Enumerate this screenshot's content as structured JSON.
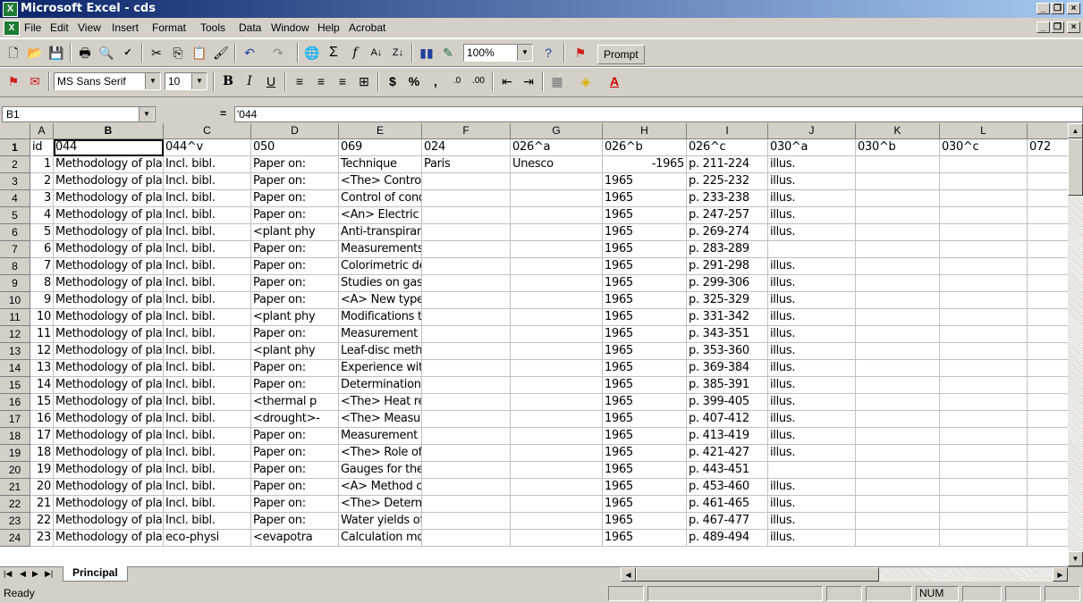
{
  "window": {
    "title": "Microsoft Excel - cds"
  },
  "menu": [
    "File",
    "Edit",
    "View",
    "Insert",
    "Format",
    "Tools",
    "Data",
    "Window",
    "Help",
    "Acrobat"
  ],
  "toolbar": {
    "zoom": "100%",
    "prompt": "Prompt",
    "font_name": "MS Sans Serif",
    "font_size": "10"
  },
  "formula_bar": {
    "cell_ref": "B1",
    "equals": "=",
    "content": "'044"
  },
  "columns": [
    "A",
    "B",
    "C",
    "D",
    "E",
    "F",
    "G",
    "H",
    "I",
    "J",
    "K",
    "L"
  ],
  "rows": [
    [
      "id",
      "044",
      "044^v",
      "050",
      "069",
      "024",
      "026^a",
      "026^b",
      "026^c",
      "030^a",
      "030^b",
      "030^c",
      "072"
    ],
    [
      "1",
      "Methodology of plant",
      "Incl. bibl.",
      "Paper on:",
      "Technique",
      "Paris",
      "Unesco",
      "-1965",
      "p. 211-224",
      "illus.",
      "",
      "",
      ""
    ],
    [
      "2",
      "Methodology of plant",
      "Incl. bibl.",
      "Paper on:",
      "<The> Controlled climate in the p",
      "",
      "",
      "1965",
      "p. 225-232",
      "illus.",
      "",
      "",
      ""
    ],
    [
      "3",
      "Methodology of plant",
      "Incl. bibl.",
      "Paper on:",
      "Control of conditions in the plant",
      "",
      "",
      "1965",
      "p. 233-238",
      "illus.",
      "",
      "",
      ""
    ],
    [
      "4",
      "Methodology of plant",
      "Incl. bibl.",
      "Paper on:",
      "<An> Electric hygrometer appara",
      "",
      "",
      "1965",
      "p. 247-257",
      "illus.",
      "",
      "",
      ""
    ],
    [
      "5",
      "Methodology of plant",
      "Incl. bibl.",
      "<plant phy",
      "Anti-transpirants as a research to",
      "",
      "",
      "1965",
      "p. 269-274",
      "illus.",
      "",
      "",
      ""
    ],
    [
      "6",
      "Methodology of plant",
      "Incl. bibl.",
      "Paper on:",
      "Measurements of plant carbon c",
      "",
      "",
      "1965",
      "p. 283-289",
      "",
      "",
      "",
      ""
    ],
    [
      "7",
      "Methodology of plant",
      "Incl. bibl.",
      "Paper on:",
      "Colorimetric determination of CC",
      "",
      "",
      "1965",
      "p. 291-298",
      "illus.",
      "",
      "",
      ""
    ],
    [
      "8",
      "Methodology of plant",
      "Incl. bibl.",
      "Paper on:",
      "Studies on gaseous exchange p",
      "",
      "",
      "1965",
      "p. 299-306",
      "illus.",
      "",
      "",
      ""
    ],
    [
      "9",
      "Methodology of plant",
      "Incl. bibl.",
      "Paper on:",
      "<A> New type of porometer for m",
      "",
      "",
      "1965",
      "p. 325-329",
      "illus.",
      "",
      "",
      ""
    ],
    [
      "10",
      "Methodology of plant",
      "Incl. bibl.",
      "<plant phy",
      "Modifications to the relative turgi",
      "",
      "",
      "1965",
      "p. 331-342",
      "illus.",
      "",
      "",
      ""
    ],
    [
      "11",
      "Methodology of plant",
      "Incl. bibl.",
      "Paper on:",
      "Measurement of water stress in p",
      "",
      "",
      "1965",
      "p. 343-351",
      "illus.",
      "",
      "",
      ""
    ],
    [
      "12",
      "Methodology of plant",
      "Incl. bibl.",
      "<plant phy",
      "Leaf-disc method for determining",
      "",
      "",
      "1965",
      "p. 353-360",
      "illus.",
      "",
      "",
      ""
    ],
    [
      "13",
      "Methodology of plant",
      "Incl. bibl.",
      "Paper on:",
      "Experience with three vapour me",
      "",
      "",
      "1965",
      "p. 369-384",
      "illus.",
      "",
      "",
      ""
    ],
    [
      "14",
      "Methodology of plant",
      "Incl. bibl.",
      "Paper on:",
      "Determination of the internal wate",
      "",
      "",
      "1965",
      "p. 385-391",
      "illus.",
      "",
      "",
      ""
    ],
    [
      "15",
      "Methodology of plant",
      "Incl. bibl.",
      "<thermal p",
      "<The> Heat resistance of plants.",
      "",
      "",
      "1965",
      "p. 399-405",
      "illus.",
      "",
      "",
      ""
    ],
    [
      "16",
      "Methodology of plant",
      "Incl. bibl.",
      "<drought>-",
      "<The> Measurement of drought",
      "",
      "",
      "1965",
      "p. 407-412",
      "illus.",
      "",
      "",
      ""
    ],
    [
      "17",
      "Methodology of plant",
      "Incl. bibl.",
      "Paper on:",
      "Measurement of drought resistan",
      "",
      "",
      "1965",
      "p. 413-419",
      "illus.",
      "",
      "",
      ""
    ],
    [
      "18",
      "Methodology of plant",
      "Incl. bibl.",
      "Paper on:",
      "<The> Role of dew in pine surviv",
      "",
      "",
      "1965",
      "p. 421-427",
      "illus.",
      "",
      "",
      ""
    ],
    [
      "19",
      "Methodology of plant",
      "Incl. bibl.",
      "Paper on:",
      "Gauges for the study of evapotra",
      "",
      "",
      "1965",
      "p. 443-451",
      "",
      "",
      "",
      ""
    ],
    [
      "20",
      "Methodology of plant",
      "Incl. bibl.",
      "Paper on:",
      "<A> Method of determining evap",
      "",
      "",
      "1965",
      "p. 453-460",
      "illus.",
      "",
      "",
      ""
    ],
    [
      "21",
      "Methodology of plant",
      "Incl. bibl.",
      "Paper on:",
      "<The> Determination of the evap",
      "",
      "",
      "1965",
      "p. 461-465",
      "illus.",
      "",
      "",
      ""
    ],
    [
      "22",
      "Methodology of plant",
      "Incl. bibl.",
      "Paper on:",
      "Water yields of forest, Maquis ar",
      "",
      "",
      "1965",
      "p. 467-477",
      "illus.",
      "",
      "",
      ""
    ],
    [
      "23",
      "Methodology of plant",
      "eco-physi",
      "<evapotra",
      "Calculation model for the actual",
      "",
      "",
      "1965",
      "p. 489-494",
      "illus.",
      "",
      "",
      ""
    ]
  ],
  "sheet_tab": "Principal",
  "status": {
    "ready": "Ready",
    "num": "NUM"
  }
}
